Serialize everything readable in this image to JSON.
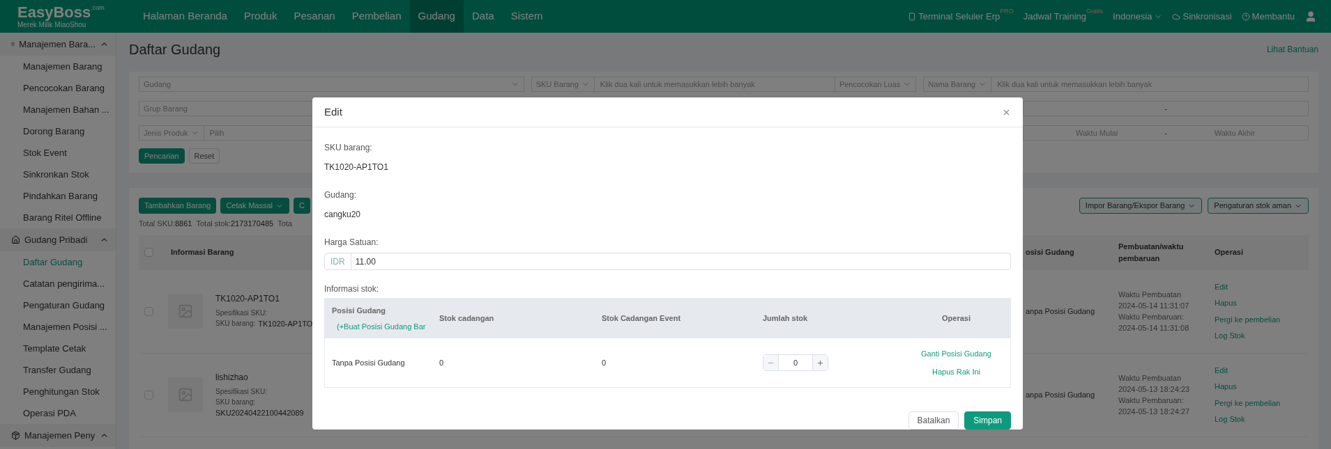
{
  "brand": {
    "name": "EasyBoss",
    "suffix": ".com",
    "tagline": "Merek Milik MiaoShou"
  },
  "nav": [
    {
      "label": "Halaman Beranda",
      "selected": false
    },
    {
      "label": "Produk",
      "selected": false
    },
    {
      "label": "Pesanan",
      "selected": false
    },
    {
      "label": "Pembelian",
      "selected": false
    },
    {
      "label": "Gudang",
      "selected": true
    },
    {
      "label": "Data",
      "selected": false
    },
    {
      "label": "Sistem",
      "selected": false
    }
  ],
  "top_actions": [
    {
      "kind": "phone",
      "label": "Terminal Seluler Erp",
      "badge": "PRO"
    },
    {
      "kind": "plain",
      "label": "Jadwal Training",
      "badge": "Gratis"
    },
    {
      "kind": "dropdown",
      "label": "Indonesia"
    },
    {
      "kind": "cloud",
      "label": "Sinkronisasi"
    },
    {
      "kind": "help",
      "label": "Membantu"
    },
    {
      "kind": "user"
    }
  ],
  "sidebar": {
    "groups": [
      {
        "label": "Manajemen Bara...",
        "expanded": true,
        "items": [
          {
            "label": "Manajemen Barang",
            "selected": false
          },
          {
            "label": "Pencocokan Barang",
            "selected": false
          },
          {
            "label": "Manajemen Bahan ...",
            "selected": false
          },
          {
            "label": "Dorong Barang",
            "selected": false
          },
          {
            "label": "Stok Event",
            "selected": false
          },
          {
            "label": "Sinkronkan Stok",
            "selected": false
          },
          {
            "label": "Pindahkan Barang",
            "selected": false
          },
          {
            "label": "Barang Ritel Offline",
            "selected": false
          }
        ]
      },
      {
        "label": "Gudang Pribadi",
        "expanded": true,
        "items": [
          {
            "label": "Daftar Gudang",
            "selected": true
          },
          {
            "label": "Catatan pengirima...",
            "selected": false
          },
          {
            "label": "Pengaturan Gudang",
            "selected": false
          },
          {
            "label": "Manajemen Posisi ...",
            "selected": false
          },
          {
            "label": "Template Cetak",
            "selected": false
          },
          {
            "label": "Transfer Gudang",
            "selected": false
          },
          {
            "label": "Penghitungan Stok",
            "selected": false
          },
          {
            "label": "Operasi PDA",
            "selected": false
          }
        ]
      },
      {
        "label": "Manajemen Peny",
        "expanded": true
      }
    ]
  },
  "page": {
    "title": "Daftar Gudang",
    "help_link": "Lihat Bantuan"
  },
  "filters": {
    "rows": [
      [
        {
          "kind": "select",
          "placeholder": "Gudang"
        },
        {
          "kind": "combo",
          "select": "SKU Barang",
          "placeholder": "Klik dua kali untuk memasukkan lebih banyak",
          "mode": "Pencocokan Luas"
        },
        {
          "kind": "combo",
          "select": "Nama Barang",
          "placeholder": "Klik dua kali untuk memasukkan lebih banyak"
        }
      ],
      [
        {
          "kind": "plain",
          "placeholder": "Grup Barang"
        },
        {
          "kind": "hidden"
        },
        {
          "kind": "range",
          "separator": "-"
        }
      ],
      [
        {
          "kind": "combo",
          "select": "Jenis Produk",
          "placeholder": "Pilih"
        },
        {
          "kind": "hidden"
        },
        {
          "kind": "range",
          "start": "Waktu Mulai",
          "separator": "-",
          "end": "Waktu Akhir"
        }
      ]
    ],
    "buttons": [
      {
        "label": "Pencarian",
        "kind": "primary"
      },
      {
        "label": "Reset",
        "kind": "secondary"
      }
    ]
  },
  "toolbar": {
    "left": [
      {
        "label": "Tambahkan Barang",
        "dropdown": false
      },
      {
        "label": "Cetak Massal",
        "dropdown": true
      },
      {
        "label": "C",
        "dropdown": false
      }
    ],
    "right": [
      {
        "label": "Impor Barang/Ekspor Barang",
        "dropdown": true
      },
      {
        "label": "Pengaturan stok aman",
        "dropdown": true
      }
    ]
  },
  "summary": [
    {
      "label": "Total SKU:",
      "value": "8861"
    },
    {
      "label": "Total stok:",
      "value": "2173170485"
    },
    {
      "label": "Tota"
    }
  ],
  "table": {
    "columns": [
      "Informasi Barang",
      "osisi Gudang",
      "Pembuatan/waktu pembaruan",
      "Operasi"
    ],
    "all_checked": false,
    "rows": [
      {
        "checked": false,
        "name": "TK1020-AP1TO1",
        "spec_label": "Spesifikasi SKU:",
        "sku_label": "SKU barang:",
        "sku": "TK1020-AP1TO",
        "position": "anpa Posisi Gudang",
        "created_label": "Waktu Pembuatan",
        "created": "2024-05-14 11:31:07",
        "updated_label": "Waktu Pembaruan:",
        "updated": "2024-05-14 11:31:08",
        "actions": [
          "Edit",
          "Hapus",
          "Pergi ke pembelian",
          "Log Stok"
        ]
      },
      {
        "checked": false,
        "name": "lishizhao",
        "spec_label": "Spesifikasi SKU:",
        "sku_label": "SKU barang:",
        "sku": "SKU20240422100442089",
        "position": "anpa Posisi Gudang",
        "created_label": "Waktu Pembuatan",
        "created": "2024-05-13 18:24:23",
        "updated_label": "Waktu Pembaruan:",
        "updated": "2024-05-13 18:24:27",
        "actions": [
          "Edit",
          "Hapus",
          "Pergi ke pembelian",
          "Log Stok"
        ]
      }
    ]
  },
  "modal": {
    "title": "Edit",
    "fields": [
      {
        "label": "SKU barang:",
        "value": "TK1020-AP1TO1"
      },
      {
        "label": "Gudang:",
        "value": "cangku20"
      }
    ],
    "price": {
      "label": "Harga Satuan:",
      "prefix": "IDR",
      "value": "11.00"
    },
    "stock": {
      "label": "Informasi stok:",
      "columns": [
        "Posisi Gudang",
        "Stok cadangan",
        "Stok Cadangan Event",
        "Jumlah stok",
        "Operasi"
      ],
      "create_link": "(+Buat Posisi Gudang Bar",
      "rows": [
        {
          "position": "Tanpa Posisi Gudang",
          "reserved": "0",
          "event_reserved": "0",
          "quantity": "0",
          "actions": [
            "Ganti Posisi Gudang",
            "Hapus Rak Ini"
          ]
        }
      ]
    },
    "buttons": [
      {
        "label": "Batalkan",
        "kind": "secondary"
      },
      {
        "label": "Simpan",
        "kind": "primary"
      }
    ]
  }
}
